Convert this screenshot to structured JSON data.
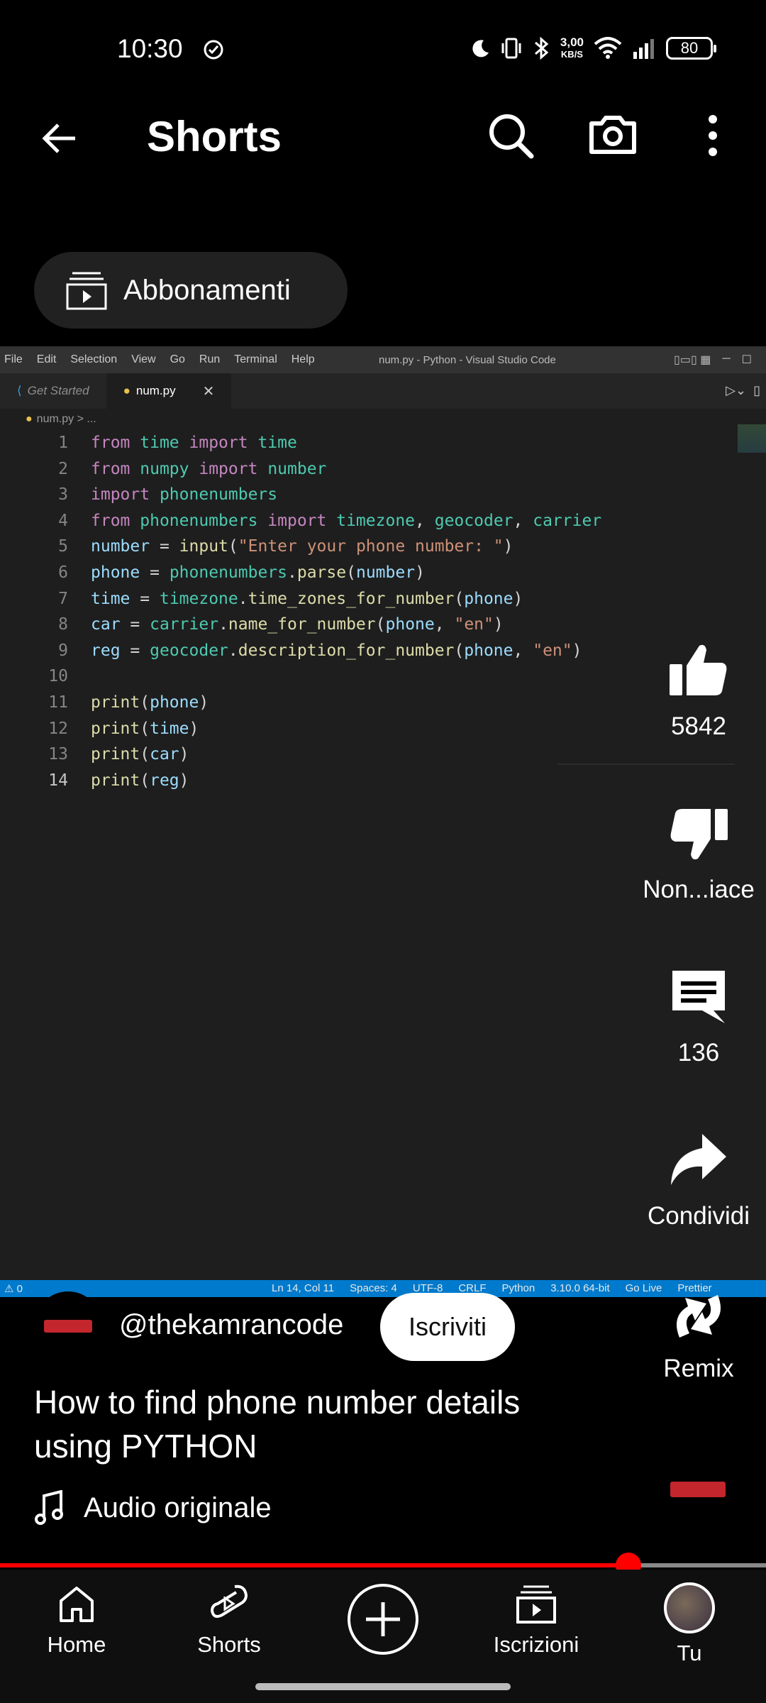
{
  "status_bar": {
    "time": "10:30",
    "speed_value": "3,00",
    "speed_unit": "KB/S",
    "battery": "80"
  },
  "header": {
    "title": "Shorts"
  },
  "chip": {
    "label": "Abbonamenti"
  },
  "video": {
    "menu": [
      "File",
      "Edit",
      "Selection",
      "View",
      "Go",
      "Run",
      "Terminal",
      "Help"
    ],
    "window_title": "num.py - Python - Visual Studio Code",
    "tabs": [
      {
        "label": "Get Started"
      },
      {
        "label": "num.py"
      }
    ],
    "breadcrumb": "num.py > ...",
    "code_lines": [
      "from time import time",
      "from numpy import number",
      "import phonenumbers",
      "from phonenumbers import timezone, geocoder, carrier",
      "number = input(\"Enter your phone number: \")",
      "phone = phonenumbers.parse(number)",
      "time = timezone.time_zones_for_number(phone)",
      "car = carrier.name_for_number(phone, \"en\")",
      "reg = geocoder.description_for_number(phone, \"en\")",
      "",
      "print(phone)",
      "print(time)",
      "print(car)",
      "print(reg)"
    ],
    "status_left": "⚠ 0",
    "status_items": [
      "Ln 14, Col 11",
      "Spaces: 4",
      "UTF-8",
      "CRLF",
      "Python",
      "3.10.0 64-bit",
      "Go Live",
      "Prettier"
    ]
  },
  "actions": {
    "like_count": "5842",
    "dislike_label": "Non...iace",
    "comment_count": "136",
    "share_label": "Condividi",
    "remix_label": "Remix"
  },
  "channel": {
    "handle": "@thekamrancode",
    "subscribe_label": "Iscriviti"
  },
  "title": "How to find phone number details using PYTHON",
  "audio": {
    "label": "Audio originale"
  },
  "progress": {
    "fraction": 0.82
  },
  "nav": {
    "home": "Home",
    "shorts": "Shorts",
    "subscriptions": "Iscrizioni",
    "you": "Tu"
  },
  "colors": {
    "accent": "#ff0000",
    "vscode_status": "#007acc"
  }
}
